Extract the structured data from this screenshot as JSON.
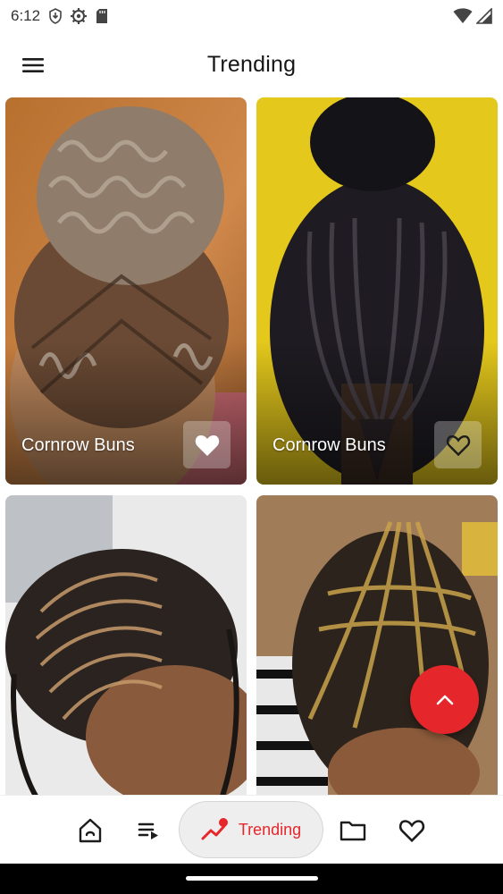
{
  "status_bar": {
    "time": "6:12"
  },
  "header": {
    "title": "Trending",
    "menu_icon": "hamburger-menu-icon"
  },
  "cards": [
    {
      "title": "Cornrow Buns",
      "favorited": true,
      "image_desc_colors": [
        "#c3773e",
        "#8a5a34"
      ]
    },
    {
      "title": "Cornrow Buns",
      "favorited": false,
      "image_desc_colors": [
        "#e2c51a",
        "#1c1b20"
      ]
    },
    {
      "title": "",
      "favorited": false,
      "image_desc_colors": [
        "#ececec",
        "#2a211d"
      ]
    },
    {
      "title": "",
      "favorited": false,
      "image_desc_colors": [
        "#9a7a5c",
        "#2c241c"
      ]
    }
  ],
  "fab": {
    "icon": "chevron-up-icon",
    "color": "#e5272c"
  },
  "bottom_nav": {
    "items": [
      {
        "id": "home",
        "icon": "home-icon"
      },
      {
        "id": "playlist",
        "icon": "playlist-icon"
      },
      {
        "id": "trending",
        "icon": "trending-icon",
        "label": "Trending",
        "active": true
      },
      {
        "id": "folder",
        "icon": "folder-icon"
      },
      {
        "id": "favorites",
        "icon": "heart-icon"
      }
    ]
  },
  "colors": {
    "accent": "#e5272c",
    "nav_pill_bg": "#eeeeee"
  }
}
